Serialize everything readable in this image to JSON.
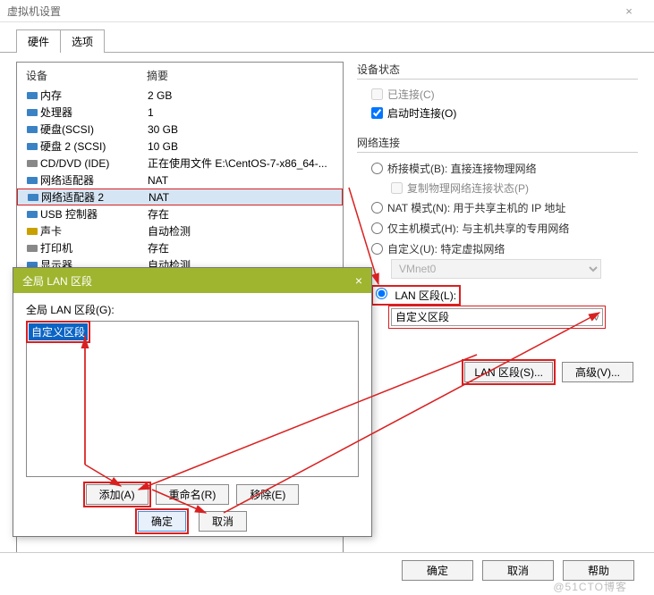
{
  "window": {
    "title": "虚拟机设置",
    "close": "×"
  },
  "tabs": {
    "hardware": "硬件",
    "options": "选项"
  },
  "hw_table": {
    "col_device": "设备",
    "col_summary": "摘要",
    "rows": [
      {
        "icon": "memory",
        "name": "内存",
        "summary": "2 GB"
      },
      {
        "icon": "cpu",
        "name": "处理器",
        "summary": "1"
      },
      {
        "icon": "disk",
        "name": "硬盘(SCSI)",
        "summary": "30 GB"
      },
      {
        "icon": "disk",
        "name": "硬盘 2 (SCSI)",
        "summary": "10 GB"
      },
      {
        "icon": "cd",
        "name": "CD/DVD (IDE)",
        "summary": "正在使用文件 E:\\CentOS-7-x86_64-..."
      },
      {
        "icon": "net",
        "name": "网络适配器",
        "summary": "NAT"
      },
      {
        "icon": "net",
        "name": "网络适配器 2",
        "summary": "NAT"
      },
      {
        "icon": "usb",
        "name": "USB 控制器",
        "summary": "存在"
      },
      {
        "icon": "sound",
        "name": "声卡",
        "summary": "自动检测"
      },
      {
        "icon": "printer",
        "name": "打印机",
        "summary": "存在"
      },
      {
        "icon": "display",
        "name": "显示器",
        "summary": "自动检测"
      }
    ]
  },
  "device_status": {
    "title": "设备状态",
    "connected": "已连接(C)",
    "connect_at_power": "启动时连接(O)"
  },
  "net_conn": {
    "title": "网络连接",
    "bridged": "桥接模式(B): 直接连接物理网络",
    "replicate": "复制物理网络连接状态(P)",
    "nat": "NAT 模式(N): 用于共享主机的 IP 地址",
    "hostonly": "仅主机模式(H): 与主机共享的专用网络",
    "custom": "自定义(U): 特定虚拟网络",
    "vmnet": "VMnet0",
    "lan": "LAN 区段(L):",
    "lan_value": "自定义区段",
    "btn_lan": "LAN 区段(S)...",
    "btn_adv": "高级(V)..."
  },
  "sub_dialog": {
    "title": "全局 LAN 区段",
    "close": "×",
    "label": "全局 LAN 区段(G):",
    "item": "自定义区段",
    "btn_add": "添加(A)",
    "btn_rename": "重命名(R)",
    "btn_remove": "移除(E)",
    "btn_ok": "确定",
    "btn_cancel": "取消"
  },
  "footer": {
    "ok": "确定",
    "cancel": "取消",
    "help": "帮助"
  },
  "watermark": "@51CTO博客"
}
